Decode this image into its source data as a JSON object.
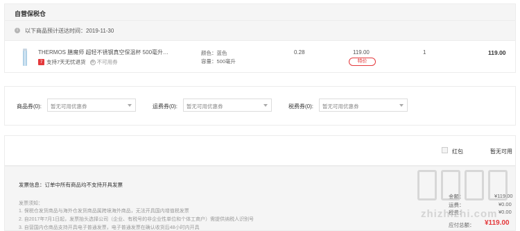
{
  "section": {
    "title": "自营保税仓"
  },
  "notice": {
    "icon": "info-icon",
    "text": "以下商品预计送达时间：2019-11-30"
  },
  "product": {
    "name": "THERMOS 膳魔师 超轻不锈钢真空保温杯 500毫升…",
    "service_badge": "7",
    "service_text": "支持7天无忧退货",
    "no_coupon_icon": "券",
    "no_coupon_text": "不可用券",
    "color_attr": "颜色：蓝色",
    "capacity_attr": "容量：500毫升",
    "tax": "0.28",
    "unit_price": "119.00",
    "special_tag": "特价",
    "quantity": "1",
    "subtotal": "119.00"
  },
  "coupons": [
    {
      "label": "商品券(0):",
      "value": "暂无可用优惠券"
    },
    {
      "label": "运费券(0):",
      "value": "暂无可用优惠券"
    },
    {
      "label": "税费券(0):",
      "value": "暂无可用优惠券"
    }
  ],
  "redpack": {
    "label": "红包",
    "status": "暂无可用"
  },
  "invoice": {
    "title": "发票信息：订单中所有商品均不支持开具发票",
    "notes_title": "发票须知：",
    "notes": [
      "1. 保税仓发货商品与海外仓发货商品属跨境海外商品，无法开具国内增值税发票",
      "2. 自2017年7月1日起，发票抬头选择公司（企业、有税号的非企业性单位和个体工商户）需提供纳税人识别号",
      "3. 自营国内仓商品支持开具电子普通发票，电子普通发票在确认收货后48小时内开具"
    ]
  },
  "summary": {
    "rows": [
      {
        "label": "金额：",
        "value": "¥119.00"
      },
      {
        "label": "运费：",
        "value": "¥0.00"
      },
      {
        "label": "税费：",
        "value": "¥0.00"
      }
    ],
    "total_label": "应付总额：",
    "total_value": "¥119.00"
  },
  "watermark": {
    "text": "zhizhizhi.com"
  },
  "colors": {
    "accent": "#e4393c",
    "panel_bg": "#f5f5f5",
    "border": "#ececec"
  }
}
